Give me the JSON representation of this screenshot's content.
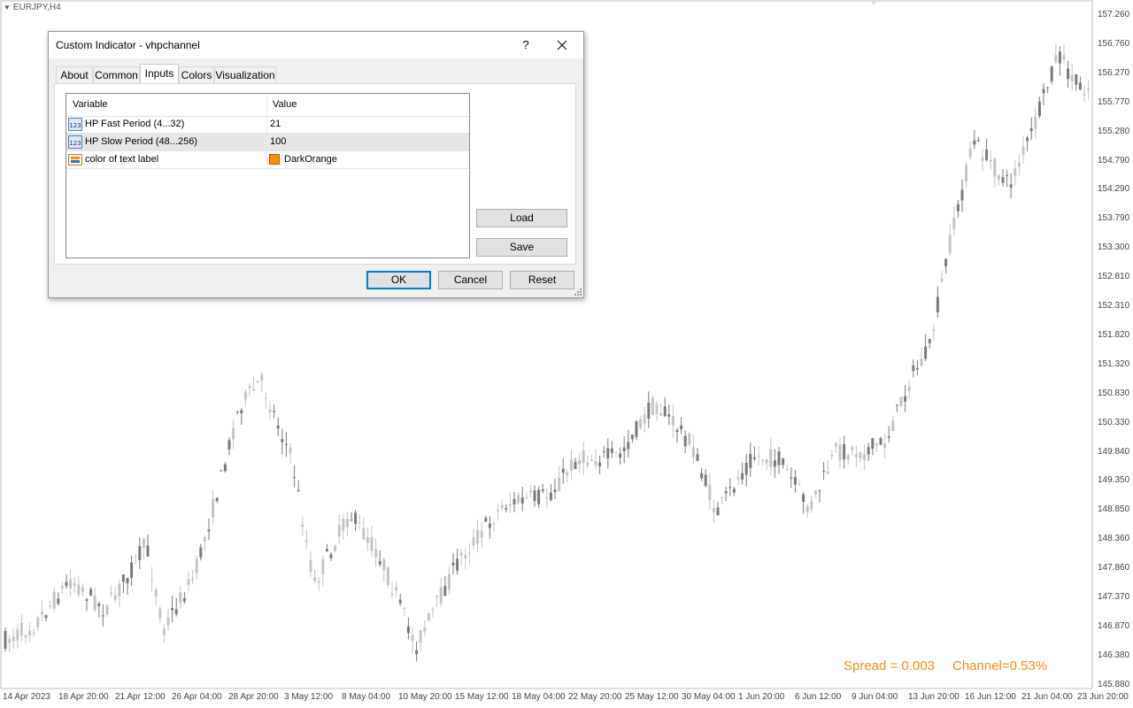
{
  "chart": {
    "symbol": "EURJPY,H4",
    "price_axis": [
      "157.260",
      "156.760",
      "156.270",
      "155.770",
      "155.280",
      "154.790",
      "154.290",
      "153.790",
      "153.300",
      "152.810",
      "152.310",
      "151.820",
      "151.320",
      "150.830",
      "150.330",
      "149.840",
      "149.350",
      "148.850",
      "148.360",
      "147.860",
      "147.370",
      "146.870",
      "146.380",
      "145.880"
    ],
    "time_axis": [
      "14 Apr 2023",
      "18 Apr 20:00",
      "21 Apr 12:00",
      "26 Apr 04:00",
      "28 Apr 20:00",
      "3 May 12:00",
      "8 May 04:00",
      "10 May 20:00",
      "15 May 12:00",
      "18 May 04:00",
      "22 May 20:00",
      "25 May 12:00",
      "30 May 04:00",
      "1 Jun 20:00",
      "6 Jun 12:00",
      "9 Jun 04:00",
      "13 Jun 20:00",
      "16 Jun 12:00",
      "21 Jun 04:00",
      "23 Jun 20:00"
    ],
    "spread_text": "Spread = 0.003",
    "channel_text": "Channel=0.53%",
    "colors": {
      "bull": "#c4c4c4",
      "bear": "#7a7a7a",
      "label": "#f0901c"
    }
  },
  "dialog": {
    "title": "Custom Indicator - vhpchannel",
    "help_label": "?",
    "tabs": [
      {
        "label": "About",
        "active": false
      },
      {
        "label": "Common",
        "active": false
      },
      {
        "label": "Inputs",
        "active": true
      },
      {
        "label": "Colors",
        "active": false
      },
      {
        "label": "Visualization",
        "active": false
      }
    ],
    "grid": {
      "col_variable": "Variable",
      "col_value": "Value",
      "rows": [
        {
          "variable": "HP Fast Period (4...32)",
          "value": "21",
          "icon": "integer-icon"
        },
        {
          "variable": "HP Slow Period (48...256)",
          "value": "100",
          "icon": "integer-icon"
        },
        {
          "variable": "color of text label",
          "value": "DarkOrange",
          "icon": "color-icon",
          "swatch": "#ff8c00"
        }
      ]
    },
    "buttons": {
      "load": "Load",
      "save": "Save",
      "ok": "OK",
      "cancel": "Cancel",
      "reset": "Reset"
    }
  }
}
